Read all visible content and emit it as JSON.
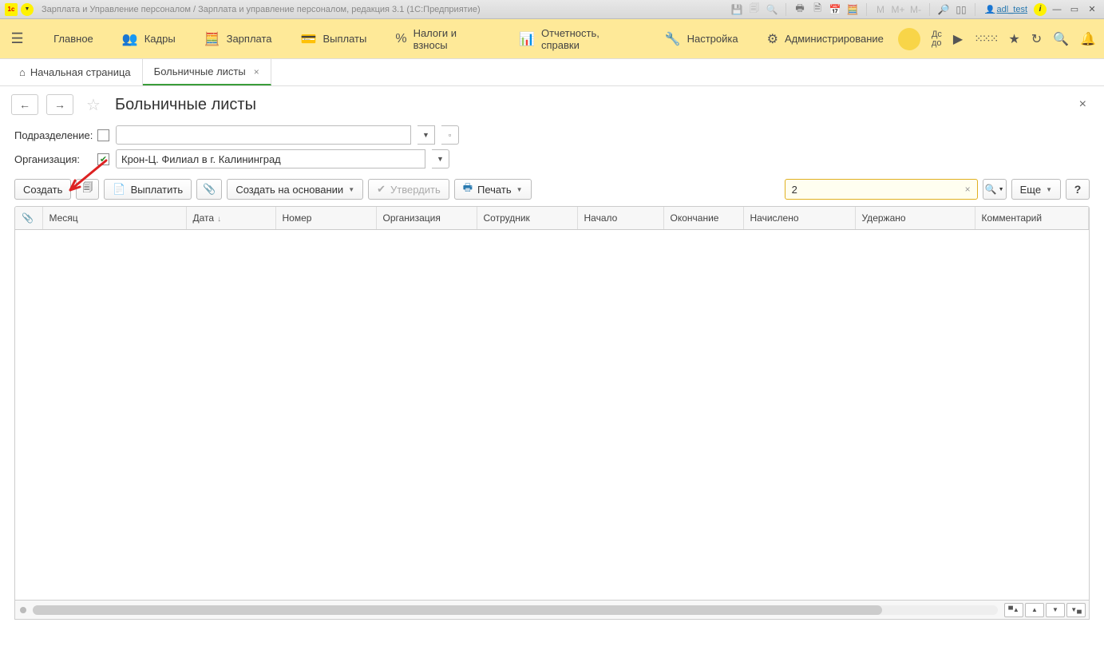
{
  "titlebar": {
    "title": "Зарплата и Управление персоналом / Зарплата и управление персоналом, редакция 3.1  (1С:Предприятие)",
    "user": "adl_test",
    "m_labels": [
      "M",
      "M+",
      "M-"
    ]
  },
  "menu": {
    "main": "Главное",
    "personnel": "Кадры",
    "salary": "Зарплата",
    "payments": "Выплаты",
    "taxes": "Налоги и взносы",
    "reports": "Отчетность, справки",
    "settings": "Настройка",
    "admin": "Администрирование",
    "do": "До\nдо"
  },
  "tabs": {
    "home": "Начальная страница",
    "sicklists": "Больничные листы"
  },
  "page": {
    "title": "Больничные листы"
  },
  "filters": {
    "department_label": "Подразделение:",
    "department_value": "",
    "organization_label": "Организация:",
    "organization_value": "Крон-Ц. Филиал в г. Калининград"
  },
  "toolbar": {
    "create": "Создать",
    "pay": "Выплатить",
    "create_based": "Создать на основании",
    "approve": "Утвердить",
    "print": "Печать",
    "search_value": "2",
    "more": "Еще"
  },
  "grid": {
    "columns": [
      "",
      "Месяц",
      "Дата",
      "Номер",
      "Организация",
      "Сотрудник",
      "Начало",
      "Окончание",
      "Начислено",
      "Удержано",
      "Комментарий"
    ]
  }
}
